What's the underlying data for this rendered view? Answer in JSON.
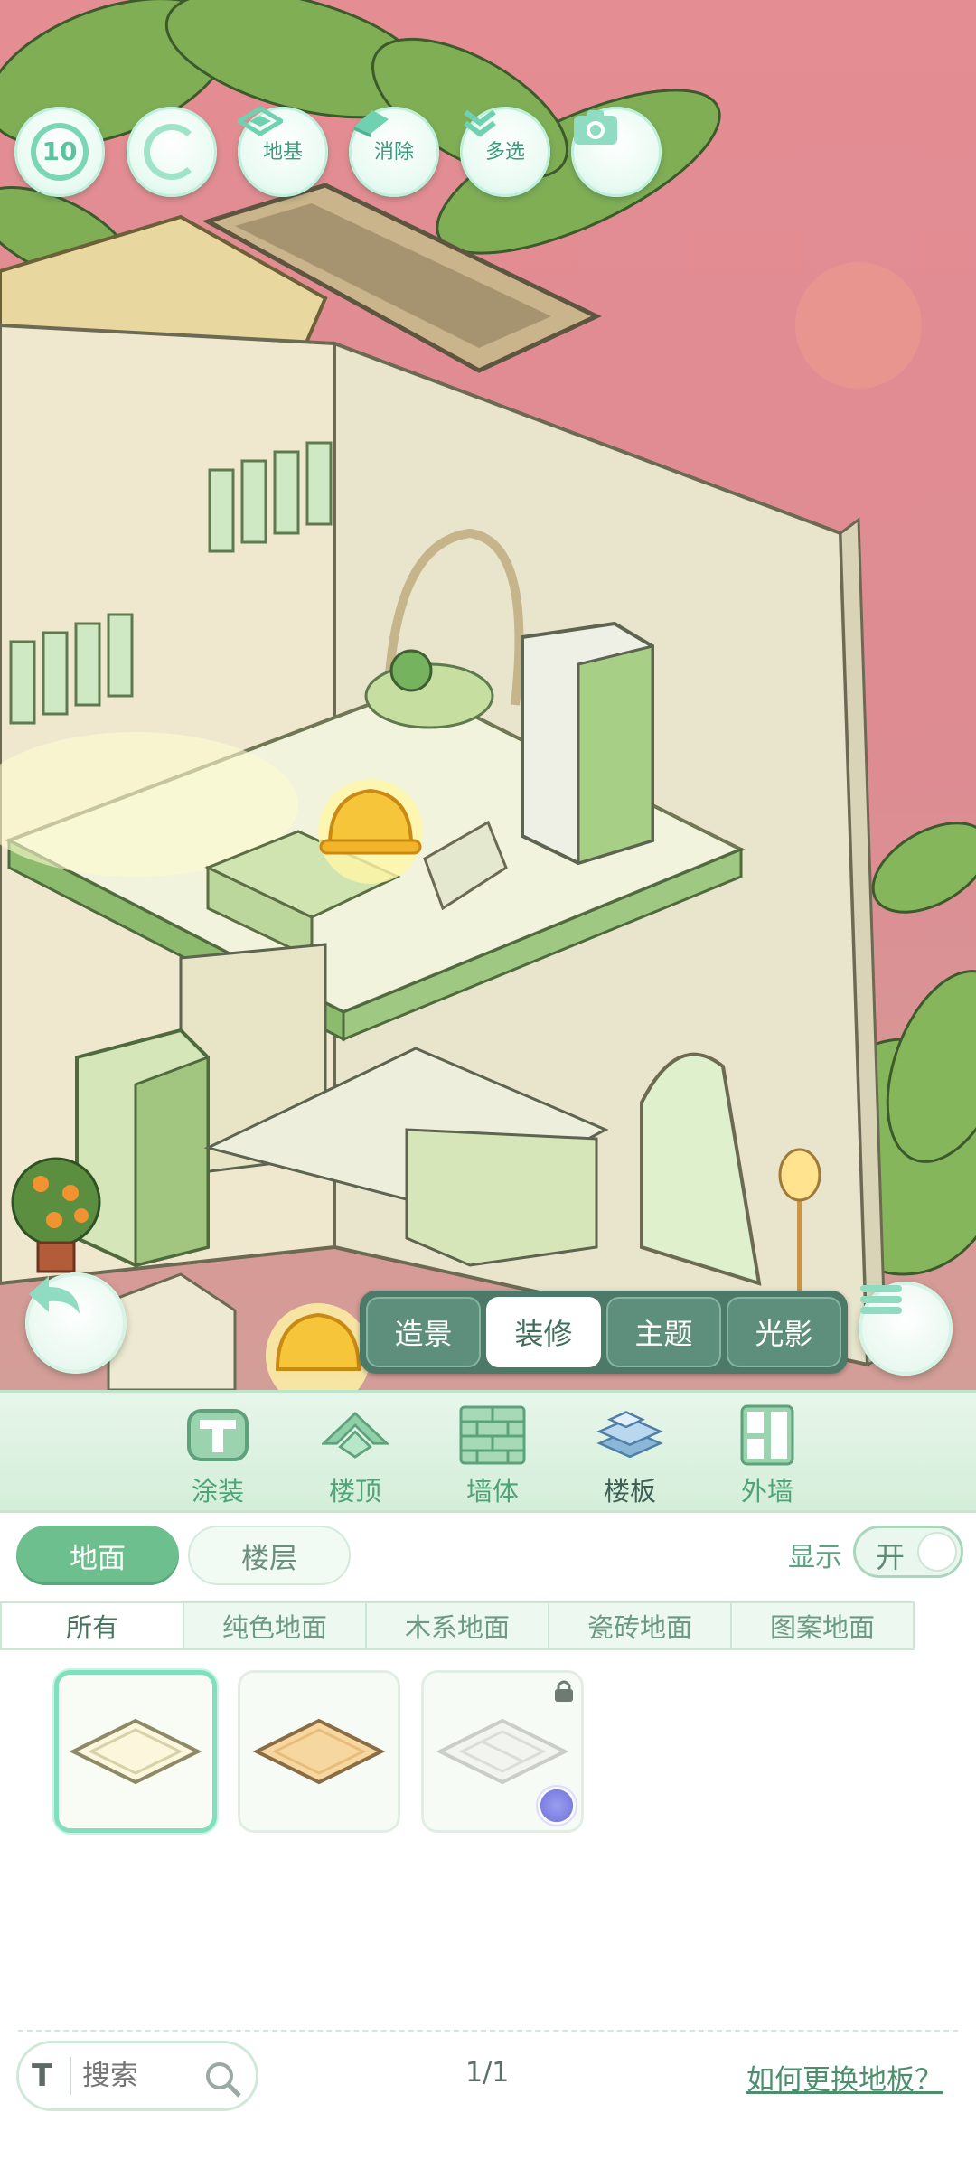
{
  "toolbar": {
    "undo_count": "10",
    "foundation_label": "地基",
    "erase_label": "消除",
    "multiselect_label": "多选"
  },
  "mode_tabs": [
    {
      "label": "造景",
      "active": false
    },
    {
      "label": "装修",
      "active": true
    },
    {
      "label": "主题",
      "active": false
    },
    {
      "label": "光影",
      "active": false
    }
  ],
  "categories": [
    {
      "label": "涂装",
      "icon": "paint-bucket-icon"
    },
    {
      "label": "楼顶",
      "icon": "roof-icon"
    },
    {
      "label": "墙体",
      "icon": "brick-wall-icon"
    },
    {
      "label": "楼板",
      "icon": "floor-tiles-icon",
      "active": true
    },
    {
      "label": "外墙",
      "icon": "window-wall-icon"
    }
  ],
  "filters": {
    "floor_pill": "地面",
    "level_pill": "楼层",
    "display_label": "显示",
    "display_toggle": "开"
  },
  "subtabs": [
    "所有",
    "纯色地面",
    "木系地面",
    "瓷砖地面",
    "图案地面"
  ],
  "items": [
    {
      "name": "cream-floor-tile",
      "selected": true,
      "locked": false
    },
    {
      "name": "peach-floor-tile",
      "selected": false,
      "locked": false
    },
    {
      "name": "patterned-floor-tile",
      "selected": false,
      "locked": true
    }
  ],
  "search": {
    "placeholder": "搜索",
    "t_icon": "T"
  },
  "pagination": "1/1",
  "help_link": "如何更换地板？",
  "colors": {
    "accent": "#6ebf8e",
    "sky": "#e48d93",
    "panel": "#e7f6ea"
  }
}
